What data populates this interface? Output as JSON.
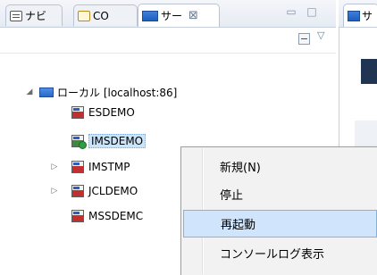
{
  "tabs": [
    {
      "label": "ナビ",
      "icon": "navigator-icon"
    },
    {
      "label": "CO",
      "icon": "console-icon"
    },
    {
      "label": "サー",
      "icon": "server-icon",
      "active": true,
      "close": "⊠"
    }
  ],
  "window_controls": {
    "minimize": "▭",
    "maximize": "□"
  },
  "view_menu_glyph": "▽",
  "tree": {
    "root": {
      "label": "ローカル [localhost:86]"
    },
    "children": [
      {
        "label": "ESDEMO",
        "expandable": false,
        "selected": false,
        "running": false
      },
      {
        "label": "IMSDEMO",
        "expandable": false,
        "selected": true,
        "running": true
      },
      {
        "label": "IMSTMP",
        "expandable": true,
        "selected": false,
        "running": false
      },
      {
        "label": "JCLDEMO",
        "expandable": true,
        "selected": false,
        "running": false
      },
      {
        "label": "MSSDEMC",
        "expandable": false,
        "selected": false,
        "running": false
      }
    ]
  },
  "right_tab": {
    "label": "サ"
  },
  "context_menu": {
    "items": [
      {
        "label": "新規(N)"
      },
      {
        "label": "停止"
      },
      {
        "label": "再起動",
        "highlighted": true
      },
      {
        "label": "コンソールログ表示"
      }
    ]
  },
  "colors": {
    "selection": "#cce4f7",
    "menu_highlight": "#d0e5fb",
    "server_blue": "#2a69c4"
  }
}
